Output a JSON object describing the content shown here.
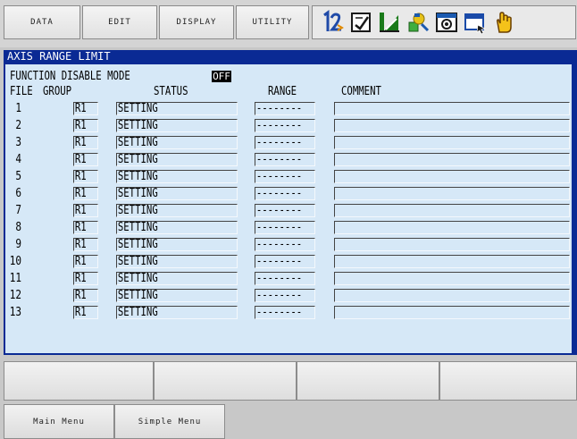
{
  "menu": [
    {
      "label": "DATA"
    },
    {
      "label": "EDIT"
    },
    {
      "label": "DISPLAY"
    },
    {
      "label": "UTILITY"
    }
  ],
  "toolbar_icons": [
    "one-two-icon",
    "memo-icon",
    "signal-icon",
    "tool-icon",
    "screen-icon",
    "window-icon",
    "hand-icon"
  ],
  "window": {
    "title": "AXIS RANGE LIMIT",
    "mode_label": "FUNCTION DISABLE MODE",
    "mode_value": "OFF",
    "headers": {
      "file": "FILE",
      "group": "GROUP",
      "status": "STATUS",
      "range": "RANGE",
      "comment": "COMMENT"
    },
    "rows": [
      {
        "file": "1",
        "group": "R1",
        "status": "SETTING",
        "range": "--------",
        "comment": ""
      },
      {
        "file": "2",
        "group": "R1",
        "status": "SETTING",
        "range": "--------",
        "comment": ""
      },
      {
        "file": "3",
        "group": "R1",
        "status": "SETTING",
        "range": "--------",
        "comment": ""
      },
      {
        "file": "4",
        "group": "R1",
        "status": "SETTING",
        "range": "--------",
        "comment": ""
      },
      {
        "file": "5",
        "group": "R1",
        "status": "SETTING",
        "range": "--------",
        "comment": ""
      },
      {
        "file": "6",
        "group": "R1",
        "status": "SETTING",
        "range": "--------",
        "comment": ""
      },
      {
        "file": "7",
        "group": "R1",
        "status": "SETTING",
        "range": "--------",
        "comment": ""
      },
      {
        "file": "8",
        "group": "R1",
        "status": "SETTING",
        "range": "--------",
        "comment": ""
      },
      {
        "file": "9",
        "group": "R1",
        "status": "SETTING",
        "range": "--------",
        "comment": ""
      },
      {
        "file": "10",
        "group": "R1",
        "status": "SETTING",
        "range": "--------",
        "comment": ""
      },
      {
        "file": "11",
        "group": "R1",
        "status": "SETTING",
        "range": "--------",
        "comment": ""
      },
      {
        "file": "12",
        "group": "R1",
        "status": "SETTING",
        "range": "--------",
        "comment": ""
      },
      {
        "file": "13",
        "group": "R1",
        "status": "SETTING",
        "range": "--------",
        "comment": ""
      }
    ]
  },
  "softkeys": [
    {
      "label": ""
    },
    {
      "label": ""
    },
    {
      "label": ""
    },
    {
      "label": ""
    }
  ],
  "bottom": {
    "main_menu": "Main Menu",
    "simple_menu": "Simple Menu"
  },
  "colors": {
    "window_frame": "#0a2a94",
    "content_bg": "#d6e8f7"
  }
}
